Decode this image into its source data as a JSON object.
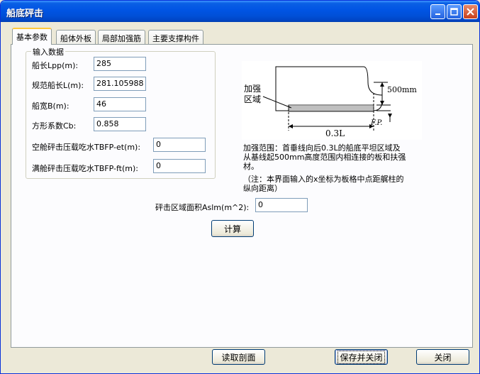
{
  "window": {
    "title": "船底砰击"
  },
  "tabs": [
    {
      "label": "基本参数"
    },
    {
      "label": "船体外板"
    },
    {
      "label": "局部加强筋"
    },
    {
      "label": "主要支撑构件"
    }
  ],
  "input_group": {
    "legend": "输入数据",
    "fields": [
      {
        "label": "船长Lpp(m):",
        "value": "285"
      },
      {
        "label": "规范船长L(m):",
        "value": "281.105988"
      },
      {
        "label": "船宽B(m):",
        "value": "46"
      },
      {
        "label": "方形系数Cb:",
        "value": "0.858"
      },
      {
        "label": "空舱砰击压载吃水TBFP-et(m):",
        "value": "0"
      },
      {
        "label": "满舱砰击压载吃水TBFP-ft(m):",
        "value": "0"
      }
    ]
  },
  "diagram": {
    "region_label_line1": "加强",
    "region_label_line2": "区域",
    "height_label": "500mm",
    "length_label": "0.3L",
    "fp_label": "F.P."
  },
  "description": {
    "range_text_line1": "加强范围：首垂线向后0.3L的船底平坦区域及",
    "range_text_line2": "从基线起500mm高度范围内相连接的板和扶强",
    "range_text_line3": "材。",
    "note_line1": "（注：本界面输入的x坐标为板格中点距艉柱的",
    "note_line2": "纵向距离）"
  },
  "area": {
    "label": "砰击区域面积Aslm(m^2):",
    "value": "0"
  },
  "buttons": {
    "calculate": "计算",
    "read_section": "读取剖面",
    "save_close": "保存并关闭",
    "close": "关闭"
  },
  "colors": {
    "title_bar": "#0054e3",
    "tab_highlight": "#ffc83c",
    "panel_bg": "#fcfcfe",
    "window_bg": "#ece9d8"
  }
}
